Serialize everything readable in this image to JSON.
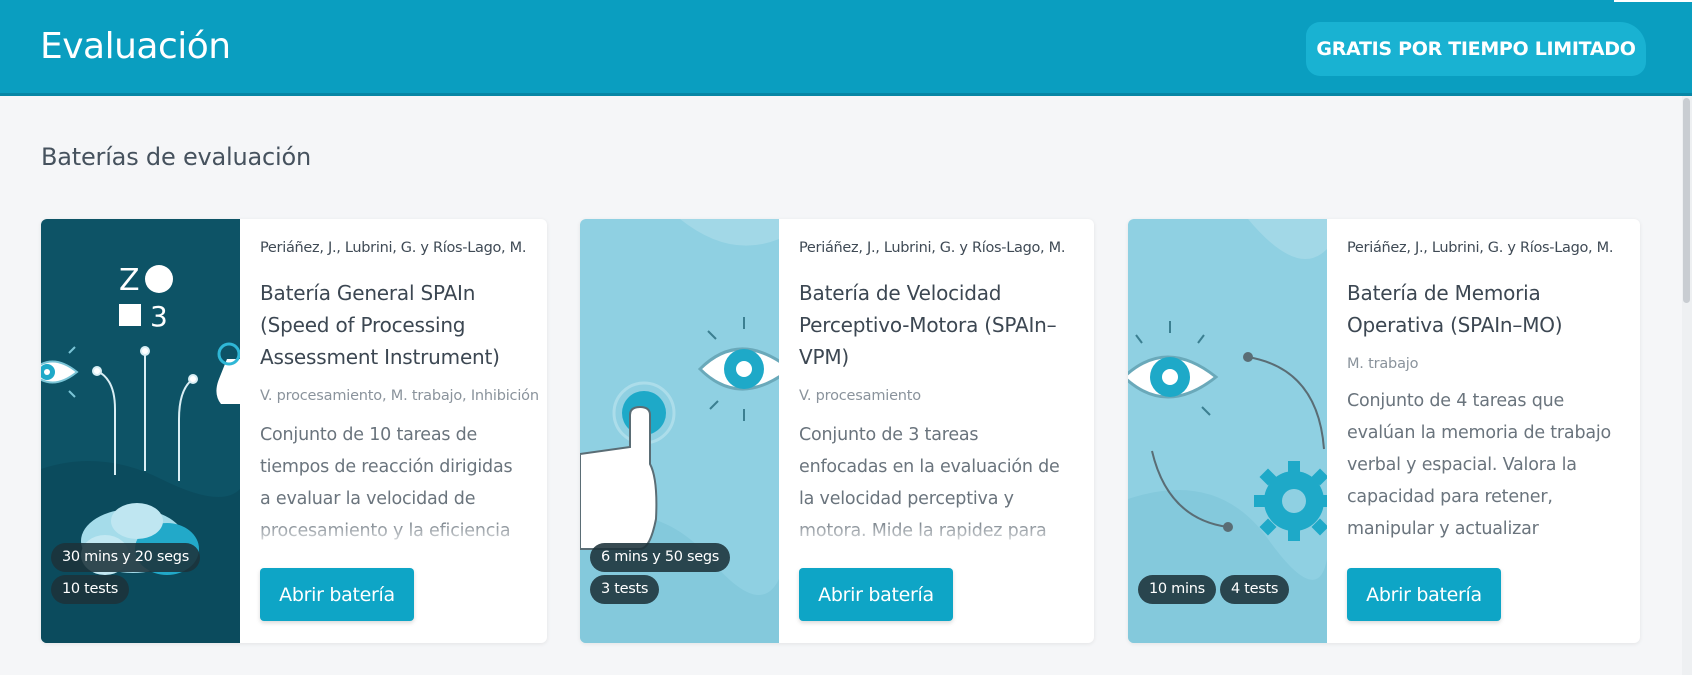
{
  "header": {
    "title": "Evaluación",
    "promo_label": "GRATIS POR TIEMPO LIMITADO"
  },
  "section": {
    "title": "Baterías de evaluación"
  },
  "cards": [
    {
      "authors": "Periáñez, J., Lubrini, G. y Ríos-Lago, M.",
      "title": "Batería General SPAIn (Speed of Processing Assessment Instrument)",
      "tags": "V. procesamiento, M. trabajo, Inhibición",
      "description": "Conjunto de 10 tareas de tiempos de reacción dirigidas a evaluar la velocidad de procesamiento y la eficiencia cognitiva. Incluye medidas com",
      "duration": "30 mins y 20 segs",
      "tests": "10 tests",
      "button_label": "Abrir batería",
      "art_text": [
        "Z",
        "3"
      ]
    },
    {
      "authors": "Periáñez, J., Lubrini, G. y Ríos-Lago, M.",
      "title": "Batería de Velocidad Perceptivo-Motora (SPAIn–VPM)",
      "tags": "V. procesamiento",
      "description": "Conjunto de 3 tareas enfocadas en la evaluación de la velocidad perceptiva y motora. Mide la rapidez para percibir estímulos y emitir respuestas motoras",
      "duration": "6 mins y 50 segs",
      "tests": "3 tests",
      "button_label": "Abrir batería"
    },
    {
      "authors": "Periáñez, J., Lubrini, G. y Ríos-Lago, M.",
      "title": "Batería de Memoria Operativa (SPAIn–MO)",
      "tags": "M. trabajo",
      "description": "Conjunto de 4 tareas que evalúan la memoria de trabajo verbal y espacial. Valora la capacidad para retener, manipular y actualizar información en tiempo real....",
      "duration": "10 mins",
      "tests": "4 tests",
      "button_label": "Abrir batería"
    }
  ],
  "colors": {
    "header_bg": "#0a9ec0",
    "promo_bg": "#19b2d2",
    "button_bg": "#0ea5c6",
    "art_dark": "#0d5366",
    "art_light": "#8fd0e2"
  },
  "icons": [
    "eye-icon",
    "pointing-hand-icon",
    "gear-icon",
    "brain-icon",
    "shapes-icon"
  ]
}
